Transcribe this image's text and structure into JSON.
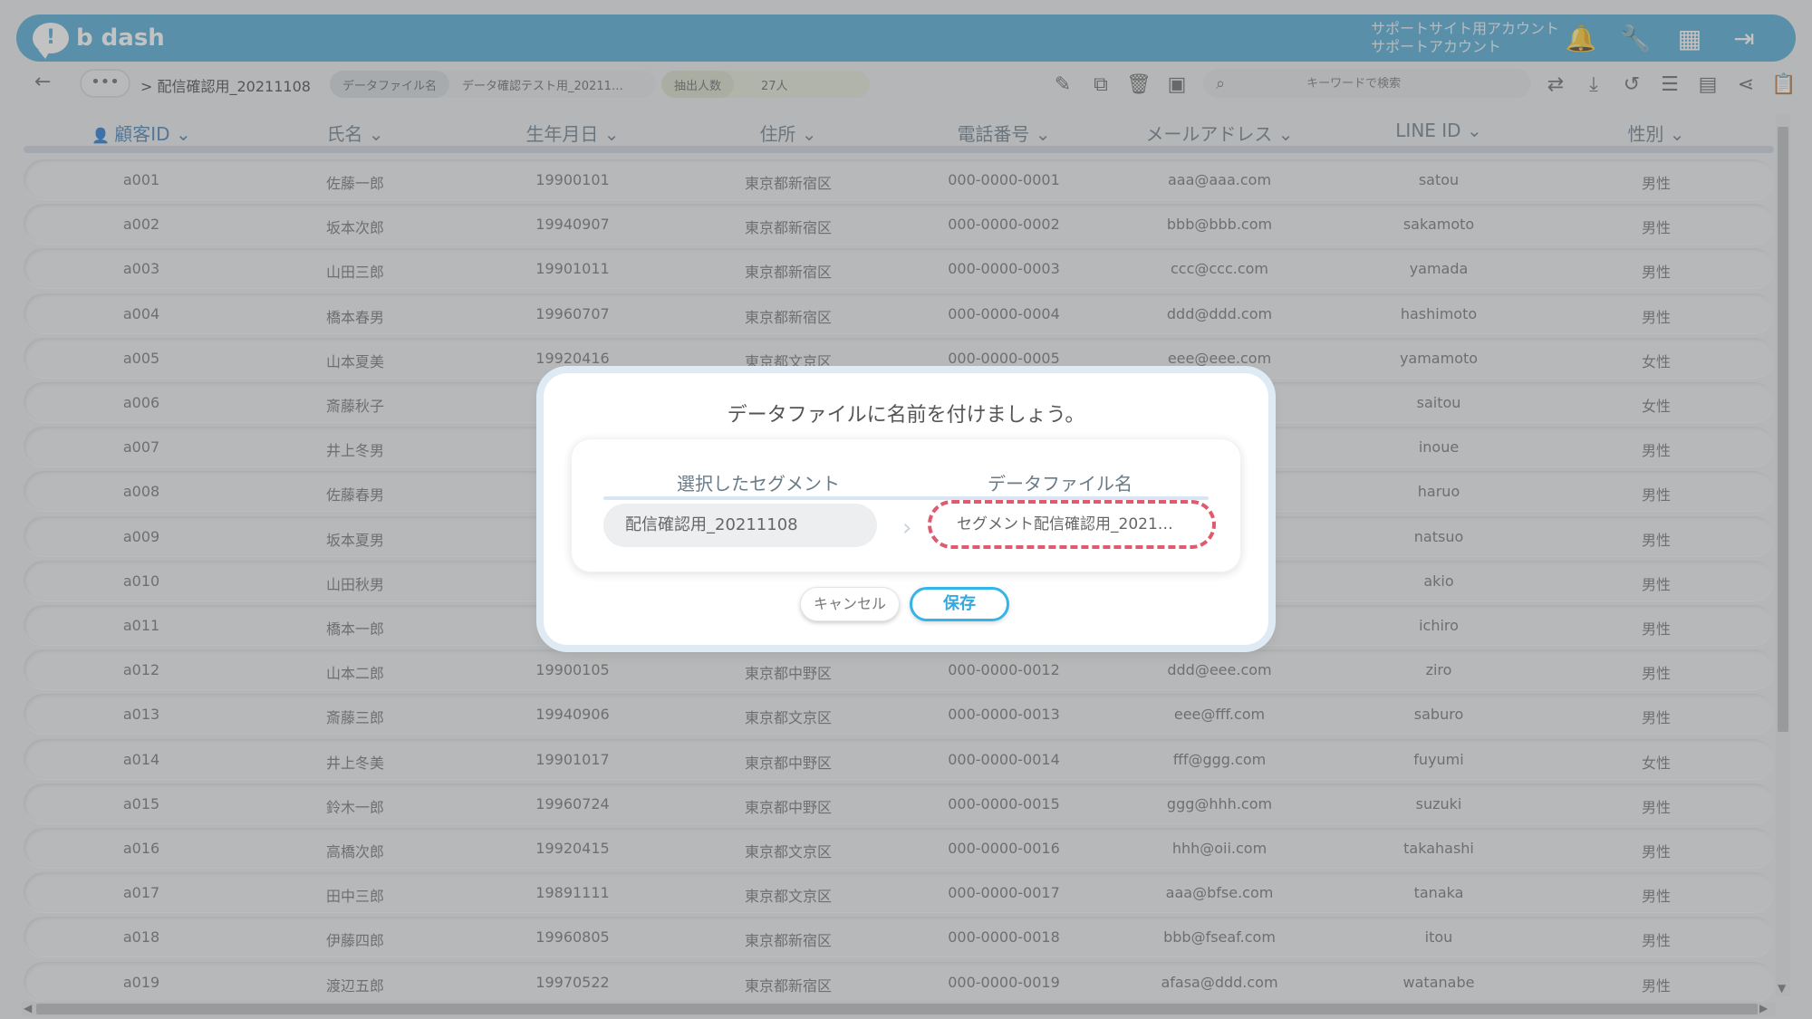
{
  "app": {
    "logo_text": "b dash",
    "logo_mark": "!",
    "account_line1": "サポートサイト用アカウント",
    "account_line2": "サポートアカウント"
  },
  "top_icons": [
    {
      "name": "bell-icon",
      "glyph": "🔔"
    },
    {
      "name": "wrench-icon",
      "glyph": "🔧"
    },
    {
      "name": "apps-grid-icon",
      "glyph": "▦"
    },
    {
      "name": "logout-icon",
      "glyph": "⇥"
    }
  ],
  "nav": {
    "back_glyph": "←",
    "more_glyph": "•••",
    "breadcrumb": "> 配信確認用_20211108",
    "datafile_label": "データファイル名",
    "datafile_value": "データ確認テスト用_20211…",
    "count_label": "抽出人数",
    "count_value": "27人",
    "search_placeholder": "キーワードで検索"
  },
  "toolbar_left": [
    {
      "name": "edit-icon",
      "glyph": "✎"
    },
    {
      "name": "copy-icon",
      "glyph": "⧉"
    },
    {
      "name": "trash-icon",
      "glyph": "🗑"
    },
    {
      "name": "archive-icon",
      "glyph": "▣"
    }
  ],
  "toolbar_right": [
    {
      "name": "repeat-icon",
      "glyph": "⇄"
    },
    {
      "name": "download-icon",
      "glyph": "⤓"
    },
    {
      "name": "history-icon",
      "glyph": "↺"
    },
    {
      "name": "list-icon",
      "glyph": "☰"
    },
    {
      "name": "document-icon",
      "glyph": "▤"
    },
    {
      "name": "share-icon",
      "glyph": "⋖"
    },
    {
      "name": "clipboard-icon",
      "glyph": "📋"
    }
  ],
  "table": {
    "columns": [
      "顧客ID",
      "氏名",
      "生年月日",
      "住所",
      "電話番号",
      "メールアドレス",
      "LINE ID",
      "性別"
    ],
    "rows": [
      [
        "a001",
        "佐藤一郎",
        "19900101",
        "東京都新宿区",
        "000-0000-0001",
        "aaa@aaa.com",
        "satou",
        "男性"
      ],
      [
        "a002",
        "坂本次郎",
        "19940907",
        "東京都新宿区",
        "000-0000-0002",
        "bbb@bbb.com",
        "sakamoto",
        "男性"
      ],
      [
        "a003",
        "山田三郎",
        "19901011",
        "東京都新宿区",
        "000-0000-0003",
        "ccc@ccc.com",
        "yamada",
        "男性"
      ],
      [
        "a004",
        "橋本春男",
        "19960707",
        "東京都新宿区",
        "000-0000-0004",
        "ddd@ddd.com",
        "hashimoto",
        "男性"
      ],
      [
        "a005",
        "山本夏美",
        "19920416",
        "東京都文京区",
        "000-0000-0005",
        "eee@eee.com",
        "yamamoto",
        "女性"
      ],
      [
        "a006",
        "斎藤秋子",
        "1",
        "",
        "",
        "",
        "saitou",
        "女性"
      ],
      [
        "a007",
        "井上冬男",
        "1",
        "",
        "",
        "",
        "inoue",
        "男性"
      ],
      [
        "a008",
        "佐藤春男",
        "1",
        "",
        "",
        "",
        "haruo",
        "男性"
      ],
      [
        "a009",
        "坂本夏男",
        "1",
        "",
        "",
        "",
        "natsuo",
        "男性"
      ],
      [
        "a010",
        "山田秋男",
        "1",
        "",
        "",
        "",
        "akio",
        "男性"
      ],
      [
        "a011",
        "橋本一郎",
        "1",
        "",
        "",
        "",
        "ichiro",
        "男性"
      ],
      [
        "a012",
        "山本二郎",
        "19900105",
        "東京都中野区",
        "000-0000-0012",
        "ddd@eee.com",
        "ziro",
        "男性"
      ],
      [
        "a013",
        "斎藤三郎",
        "19940906",
        "東京都文京区",
        "000-0000-0013",
        "eee@fff.com",
        "saburo",
        "男性"
      ],
      [
        "a014",
        "井上冬美",
        "19901017",
        "東京都中野区",
        "000-0000-0014",
        "fff@ggg.com",
        "fuyumi",
        "女性"
      ],
      [
        "a015",
        "鈴木一郎",
        "19960724",
        "東京都中野区",
        "000-0000-0015",
        "ggg@hhh.com",
        "suzuki",
        "男性"
      ],
      [
        "a016",
        "高橋次郎",
        "19920415",
        "東京都文京区",
        "000-0000-0016",
        "hhh@oii.com",
        "takahashi",
        "男性"
      ],
      [
        "a017",
        "田中三郎",
        "19891111",
        "東京都文京区",
        "000-0000-0017",
        "aaa@bfse.com",
        "tanaka",
        "男性"
      ],
      [
        "a018",
        "伊藤四郎",
        "19960805",
        "東京都新宿区",
        "000-0000-0018",
        "bbb@fseaf.com",
        "itou",
        "男性"
      ],
      [
        "a019",
        "渡辺五郎",
        "19970522",
        "東京都新宿区",
        "000-0000-0019",
        "afasa@ddd.com",
        "watanabe",
        "男性"
      ]
    ]
  },
  "modal": {
    "title": "データファイルに名前を付けましょう。",
    "selected_segment_header": "選択したセグメント",
    "datafile_name_header": "データファイル名",
    "selected_segment_value": "配信確認用_20211108",
    "datafile_name_value": "セグメント配信確認用_2021…",
    "cancel_label": "キャンセル",
    "save_label": "保存",
    "arrow_glyph": "›"
  },
  "colors": {
    "brand": "#4aa8d2",
    "save_accent": "#35b4e8",
    "highlight_dash": "#e05a6d"
  }
}
